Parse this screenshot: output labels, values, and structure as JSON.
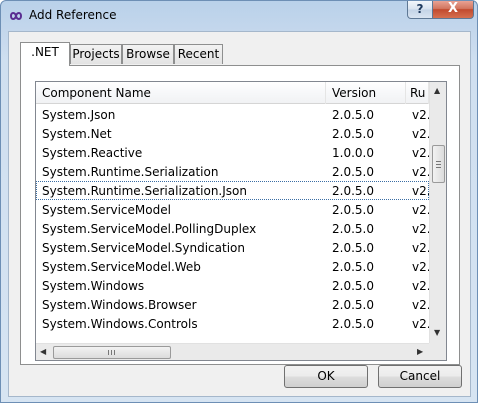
{
  "window": {
    "title": "Add Reference",
    "help_label": "?",
    "close_label": "X",
    "icon": "infinity-icon"
  },
  "tabs": [
    {
      "label": ".NET",
      "active": true
    },
    {
      "label": "Projects",
      "active": false
    },
    {
      "label": "Browse",
      "active": false
    },
    {
      "label": "Recent",
      "active": false
    }
  ],
  "list": {
    "columns": {
      "name": "Component Name",
      "version": "Version",
      "runtime": "Ru"
    },
    "rows": [
      {
        "name": "System.Json",
        "version": "2.0.5.0",
        "runtime": "v2."
      },
      {
        "name": "System.Net",
        "version": "2.0.5.0",
        "runtime": "v2."
      },
      {
        "name": "System.Reactive",
        "version": "1.0.0.0",
        "runtime": "v2."
      },
      {
        "name": "System.Runtime.Serialization",
        "version": "2.0.5.0",
        "runtime": "v2."
      },
      {
        "name": "System.Runtime.Serialization.Json",
        "version": "2.0.5.0",
        "runtime": "v2.",
        "selected": true
      },
      {
        "name": "System.ServiceModel",
        "version": "2.0.5.0",
        "runtime": "v2."
      },
      {
        "name": "System.ServiceModel.PollingDuplex",
        "version": "2.0.5.0",
        "runtime": "v2."
      },
      {
        "name": "System.ServiceModel.Syndication",
        "version": "2.0.5.0",
        "runtime": "v2."
      },
      {
        "name": "System.ServiceModel.Web",
        "version": "2.0.5.0",
        "runtime": "v2."
      },
      {
        "name": "System.Windows",
        "version": "2.0.5.0",
        "runtime": "v2."
      },
      {
        "name": "System.Windows.Browser",
        "version": "2.0.5.0",
        "runtime": "v2."
      },
      {
        "name": "System.Windows.Controls",
        "version": "2.0.5.0",
        "runtime": "v2."
      }
    ]
  },
  "buttons": {
    "ok": "OK",
    "cancel": "Cancel"
  }
}
